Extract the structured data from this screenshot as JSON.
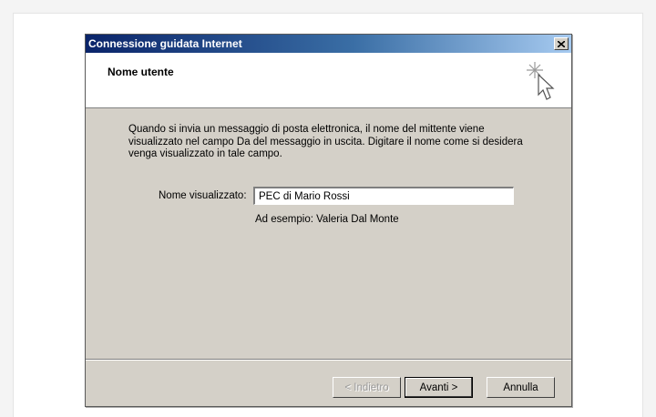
{
  "window": {
    "title": "Connessione guidata Internet",
    "close_symbol": "x"
  },
  "header": {
    "title": "Nome utente",
    "icon": "wizard-sparkle-cursor-icon"
  },
  "body": {
    "description": "Quando si invia un messaggio di posta elettronica, il nome del mittente viene visualizzato nel campo Da del messaggio in uscita. Digitare il nome come si desidera venga visualizzato in tale campo.",
    "field_label": "Nome visualizzato:",
    "field_value": "PEC di Mario Rossi",
    "example": "Ad esempio: Valeria Dal Monte"
  },
  "buttons": {
    "back": "< Indietro",
    "next": "Avanti >",
    "cancel": "Annulla"
  },
  "colors": {
    "titlebar_start": "#0a246a",
    "titlebar_end": "#a6caf0",
    "dialog_face": "#d4d0c8"
  }
}
